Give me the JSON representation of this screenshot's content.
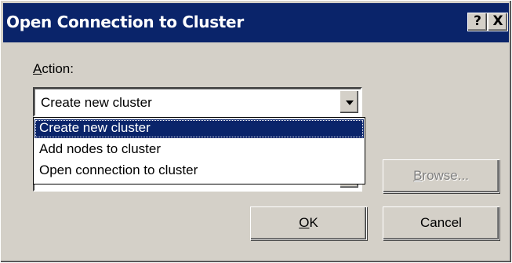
{
  "window": {
    "title": "Open Connection to Cluster",
    "help_label": "?",
    "close_label": "X"
  },
  "action": {
    "label_first": "A",
    "label_rest": "ction:",
    "selected": "Create new cluster",
    "options": [
      "Create new cluster",
      "Add nodes to cluster",
      "Open connection to cluster"
    ]
  },
  "buttons": {
    "browse_first": "B",
    "browse_rest": "rowse...",
    "ok_first": "O",
    "ok_rest": "K",
    "cancel": "Cancel"
  }
}
